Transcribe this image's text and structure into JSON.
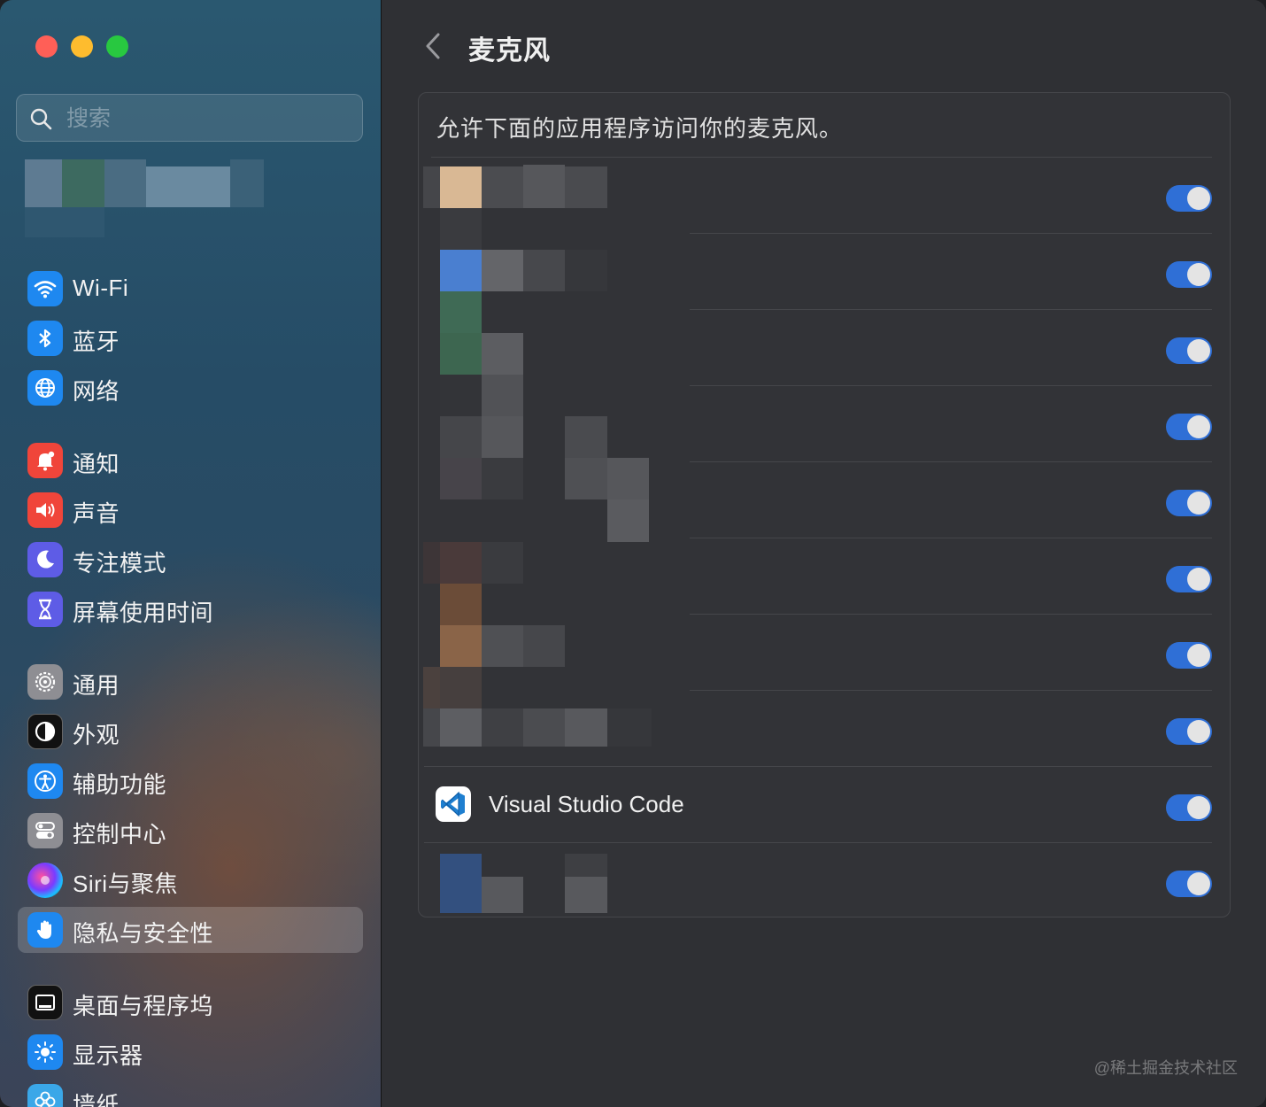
{
  "window": {
    "traffic_lights": [
      "close",
      "minimize",
      "zoom"
    ]
  },
  "search": {
    "placeholder": "搜索",
    "value": ""
  },
  "sidebar": {
    "items": [
      {
        "label": "Wi-Fi",
        "icon": "wifi-icon",
        "color": "#1e88f0"
      },
      {
        "label": "蓝牙",
        "icon": "bluetooth-icon",
        "color": "#1e88f0"
      },
      {
        "label": "网络",
        "icon": "globe-icon",
        "color": "#1e88f0"
      },
      {
        "label": "通知",
        "icon": "bell-icon",
        "color": "#f0453a"
      },
      {
        "label": "声音",
        "icon": "speaker-icon",
        "color": "#f0453a"
      },
      {
        "label": "专注模式",
        "icon": "moon-icon",
        "color": "#5e5ce6"
      },
      {
        "label": "屏幕使用时间",
        "icon": "hourglass-icon",
        "color": "#5e5ce6"
      },
      {
        "label": "通用",
        "icon": "gear-icon",
        "color": "#8e8e93"
      },
      {
        "label": "外观",
        "icon": "appearance-icon",
        "color": "#111111"
      },
      {
        "label": "辅助功能",
        "icon": "accessibility-icon",
        "color": "#1e88f0"
      },
      {
        "label": "控制中心",
        "icon": "toggles-icon",
        "color": "#8e8e93"
      },
      {
        "label": "Siri与聚焦",
        "icon": "siri-icon",
        "color": "#222222"
      },
      {
        "label": "隐私与安全性",
        "icon": "hand-icon",
        "color": "#1e88f0",
        "selected": true
      },
      {
        "label": "桌面与程序坞",
        "icon": "dock-icon",
        "color": "#111111"
      },
      {
        "label": "显示器",
        "icon": "sun-icon",
        "color": "#1e88f0"
      },
      {
        "label": "墙纸",
        "icon": "flower-icon",
        "color": "#3aa7e8"
      }
    ]
  },
  "main": {
    "title": "麦克风",
    "description": "允许下面的应用程序访问你的麦克风。",
    "apps": [
      {
        "name": "",
        "enabled": true
      },
      {
        "name": "",
        "enabled": true
      },
      {
        "name": "",
        "enabled": true
      },
      {
        "name": "",
        "enabled": true
      },
      {
        "name": "",
        "enabled": true
      },
      {
        "name": "",
        "enabled": true
      },
      {
        "name": "",
        "enabled": true
      },
      {
        "name": "",
        "enabled": true
      },
      {
        "name": "Visual Studio Code",
        "enabled": true,
        "icon": "vscode-icon"
      },
      {
        "name": "",
        "enabled": true
      }
    ]
  },
  "watermark": "@稀土掘金技术社区",
  "colors": {
    "accent": "#2f6fd6",
    "panel": "#323337",
    "background": "#2f3034"
  }
}
